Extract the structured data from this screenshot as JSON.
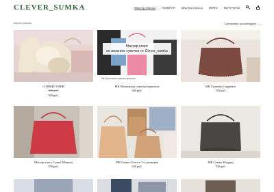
{
  "header": {
    "logo": "CLEVER_SUMKA",
    "nav": [
      "Мастер классы",
      "ГЛАВНАЯ",
      "Мастер классы",
      "ИНФО",
      "КОНТАКТЫ"
    ]
  },
  "breadcrumb": "мастер классы",
  "sort": {
    "label": "Сортировка: рекомендуем"
  },
  "colors": {
    "logo": "#2f5e3a",
    "text": "#222222",
    "muted": "#888888"
  },
  "products": [
    {
      "name": "СОВМЕСТНИК",
      "old_price": "700 руб.",
      "price": "500 руб."
    },
    {
      "name": "МК Маленькая сумочка крючком",
      "price": "500 руб.",
      "overlay": "Мастер класс\nпо вязанию сумочки от Clever_sumka",
      "badge": "МК Маленькая сумочка крючком"
    },
    {
      "name": "МК Сумочка Сорренто",
      "price": "700 руб."
    },
    {
      "name": "Мастер класс Сумка Манила",
      "price": "700 руб."
    },
    {
      "name": "МК Сумка-Тоете в 3-х размерах",
      "price": "650 руб."
    },
    {
      "name": "МК Сумка Мадрид",
      "price": "700 руб."
    }
  ]
}
